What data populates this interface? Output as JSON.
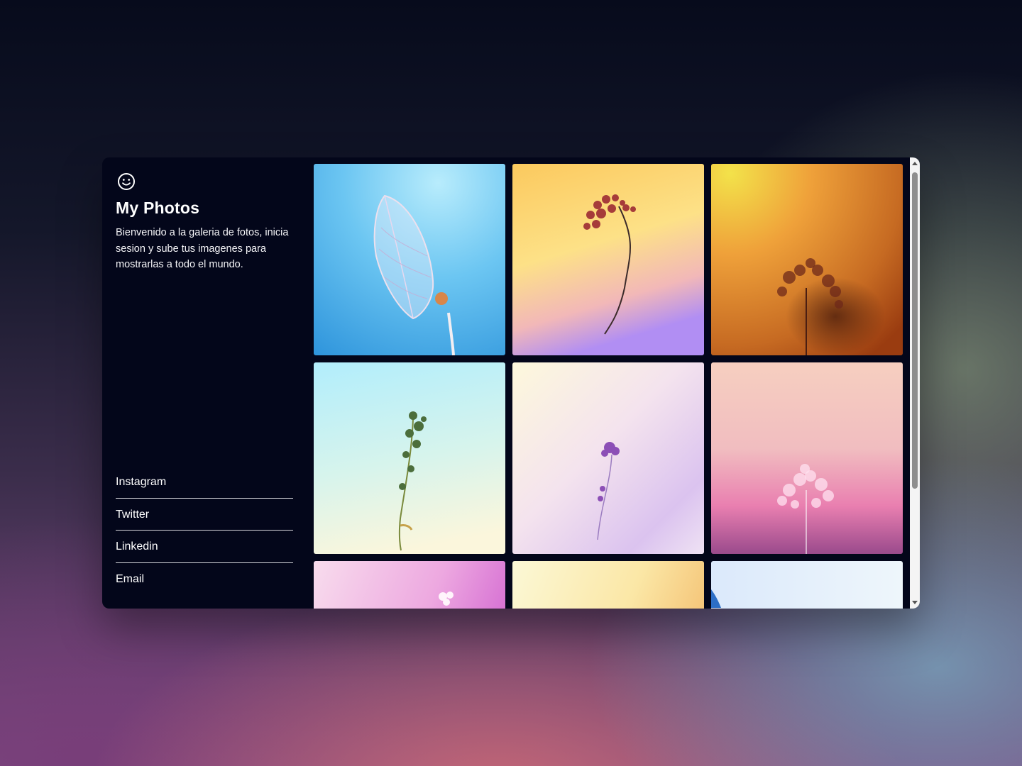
{
  "sidebar": {
    "logo_icon": "smiley-face-icon",
    "title": "My Photos",
    "description": "Bienvenido a la galeria de fotos, inicia sesion y sube tus imagenes para mostrarlas a todo el mundo.",
    "links": [
      {
        "label": "Instagram"
      },
      {
        "label": "Twitter"
      },
      {
        "label": "Linkedin"
      },
      {
        "label": "Email"
      }
    ]
  },
  "gallery": {
    "photos": [
      {
        "subject": "transparent-leaf-skeleton",
        "colors": [
          "#a4e4fb",
          "#3fa6e6"
        ]
      },
      {
        "subject": "red-dried-flower",
        "colors": [
          "#fbd86b",
          "#b48af0"
        ]
      },
      {
        "subject": "dark-tree-silhouette",
        "colors": [
          "#f3c64a",
          "#9a3c10"
        ]
      },
      {
        "subject": "green-wildflower-stem",
        "colors": [
          "#b5eefa",
          "#fbf6dc"
        ]
      },
      {
        "subject": "purple-flower",
        "colors": [
          "#fdf7da",
          "#d3b7ee"
        ]
      },
      {
        "subject": "pink-fern-leaf",
        "colors": [
          "#f7cabd",
          "#a04e8c"
        ]
      },
      {
        "subject": "white-blossom",
        "colors": [
          "#f6d0ee",
          "#d776d7"
        ]
      },
      {
        "subject": "yellow-gradient",
        "colors": [
          "#fbf7d1",
          "#f9cf7a"
        ]
      },
      {
        "subject": "blue-leaf-edge",
        "colors": [
          "#dbe8fb",
          "#eaf4fb"
        ]
      }
    ]
  }
}
